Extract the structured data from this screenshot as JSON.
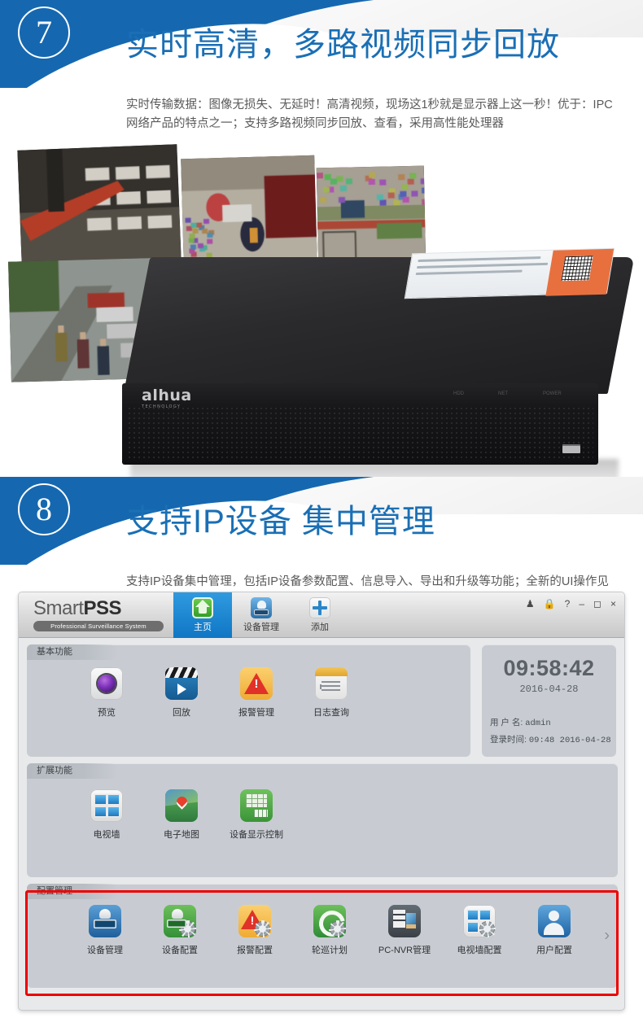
{
  "sections": [
    {
      "badge": "7",
      "title": "实时高清，多路视频同步回放",
      "desc": "实时传输数据：图像无损失、无延时！高清视频，现场这1秒就是显示器上这一秒！优于：IPC网络产品的特点之一；支持多路视频同步回放、查看，采用高性能处理器"
    },
    {
      "badge": "8",
      "title": "支持IP设备 集中管理",
      "desc": "支持IP设备集中管理，包括IP设备参数配置、信息导入、导出和升级等功能；全新的UI操作见面，支持一键添加IP设备以及一键开启录像功能"
    }
  ],
  "device": {
    "brand": "alhua",
    "brand_sub": "TECHNOLOGY",
    "leds": [
      "HDD",
      "NET",
      "POWER"
    ]
  },
  "app": {
    "brand": {
      "light": "Smart",
      "bold": "PSS",
      "tagline": "Professional Surveillance System"
    },
    "tabs": [
      {
        "label": "主页",
        "icon": "home-icon",
        "active": true
      },
      {
        "label": "设备管理",
        "icon": "device-manager-icon",
        "active": false
      },
      {
        "label": "添加",
        "icon": "plus-icon",
        "active": false
      }
    ],
    "window_buttons": [
      {
        "name": "user-icon",
        "glyph": "♟"
      },
      {
        "name": "lock-icon",
        "glyph": "ὑ2"
      },
      {
        "name": "help-icon",
        "glyph": "?"
      },
      {
        "name": "minimize-icon",
        "glyph": "–"
      },
      {
        "name": "maximize-icon",
        "glyph": "□"
      },
      {
        "name": "close-icon",
        "glyph": "×"
      }
    ],
    "panels": [
      {
        "title": "基本功能",
        "items": [
          {
            "label": "预览",
            "icon": "preview-icon"
          },
          {
            "label": "回放",
            "icon": "playback-icon"
          },
          {
            "label": "报警管理",
            "icon": "alarm-manage-icon"
          },
          {
            "label": "日志查询",
            "icon": "log-query-icon"
          }
        ]
      },
      {
        "title": "扩展功能",
        "items": [
          {
            "label": "电视墙",
            "icon": "tv-wall-icon"
          },
          {
            "label": "电子地图",
            "icon": "e-map-icon"
          },
          {
            "label": "设备显示控制",
            "icon": "display-control-icon"
          }
        ]
      },
      {
        "title": "配置管理",
        "highlighted": true,
        "items": [
          {
            "label": "设备管理",
            "icon": "device-manage-icon"
          },
          {
            "label": "设备配置",
            "icon": "device-config-icon"
          },
          {
            "label": "报警配置",
            "icon": "alarm-config-icon"
          },
          {
            "label": "轮巡计划",
            "icon": "tour-plan-icon"
          },
          {
            "label": "PC-NVR管理",
            "icon": "pc-nvr-icon"
          },
          {
            "label": "电视墙配置",
            "icon": "tv-wall-config-icon"
          },
          {
            "label": "用户配置",
            "icon": "user-config-icon"
          }
        ],
        "more": "›"
      }
    ],
    "clock": {
      "time": "09:58:42",
      "date": "2016-04-28",
      "user_label": "用 户 名:",
      "user_value": "admin",
      "login_label": "登录时间:",
      "login_value": "09:48 2016-04-28"
    }
  },
  "colors": {
    "brand_blue": "#1568b0",
    "title_blue": "#1a6fb5",
    "highlight_red": "#ee0000",
    "tab_active": "#0f76c4"
  }
}
